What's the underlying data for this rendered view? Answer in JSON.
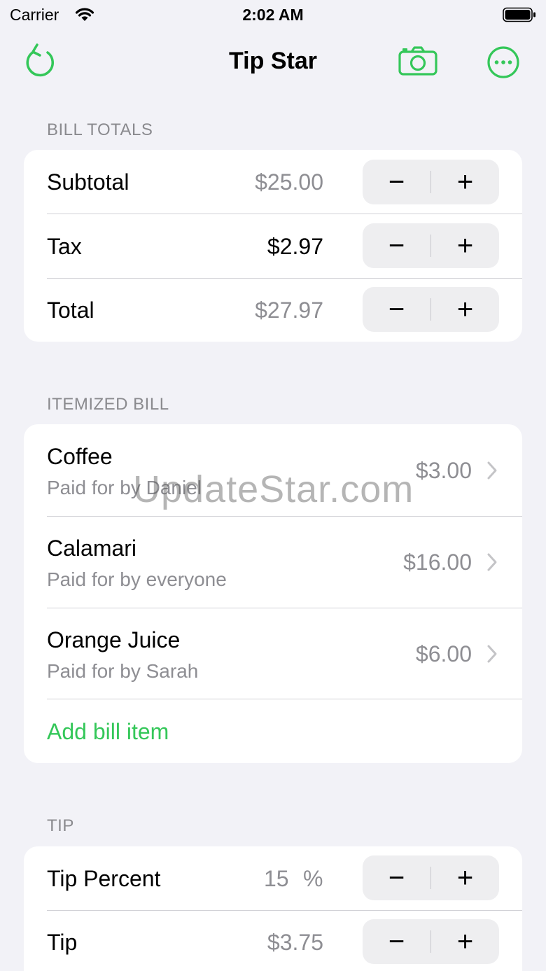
{
  "status_bar": {
    "carrier": "Carrier",
    "time": "2:02 AM"
  },
  "nav": {
    "title": "Tip Star",
    "icons": [
      "undo-icon",
      "camera-icon",
      "more-icon"
    ]
  },
  "accent_color": "#34c759",
  "bill_totals": {
    "header": "BILL TOTALS",
    "rows": [
      {
        "label": "Subtotal",
        "value": "$25.00",
        "minus": "−",
        "plus": "+"
      },
      {
        "label": "Tax",
        "value": "$2.97",
        "minus": "−",
        "plus": "+"
      },
      {
        "label": "Total",
        "value": "$27.97",
        "minus": "−",
        "plus": "+"
      }
    ]
  },
  "itemized": {
    "header": "ITEMIZED BILL",
    "items": [
      {
        "title": "Coffee",
        "subtitle": "Paid for by Daniel",
        "price": "$3.00"
      },
      {
        "title": "Calamari",
        "subtitle": "Paid for by everyone",
        "price": "$16.00"
      },
      {
        "title": "Orange Juice",
        "subtitle": "Paid for by Sarah",
        "price": "$6.00"
      }
    ],
    "add_label": "Add bill item"
  },
  "tip": {
    "header": "TIP",
    "percent_label": "Tip Percent",
    "percent_value": "15",
    "percent_sign": "%",
    "tip_label": "Tip",
    "tip_value": "$3.75",
    "minus": "−",
    "plus": "+"
  },
  "watermark": "UpdateStar.com"
}
